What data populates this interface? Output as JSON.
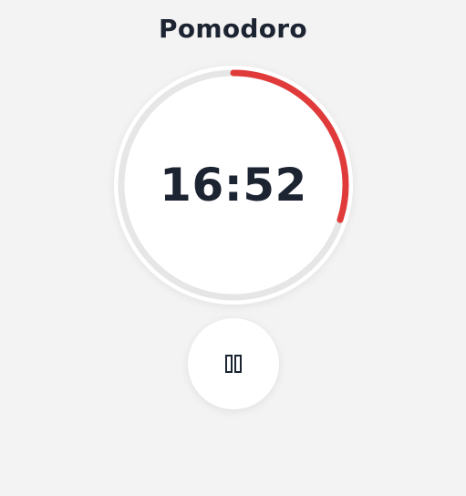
{
  "app": {
    "title": "Pomodoro"
  },
  "timer": {
    "time_display": "16:52",
    "progress_fraction": 0.3,
    "progress_color": "#e03a3a",
    "track_color": "#e6e6e6"
  },
  "controls": {
    "pause_icon": "pause-icon"
  },
  "colors": {
    "background": "#f3f3f3",
    "text": "#1c2331",
    "surface": "#ffffff"
  }
}
